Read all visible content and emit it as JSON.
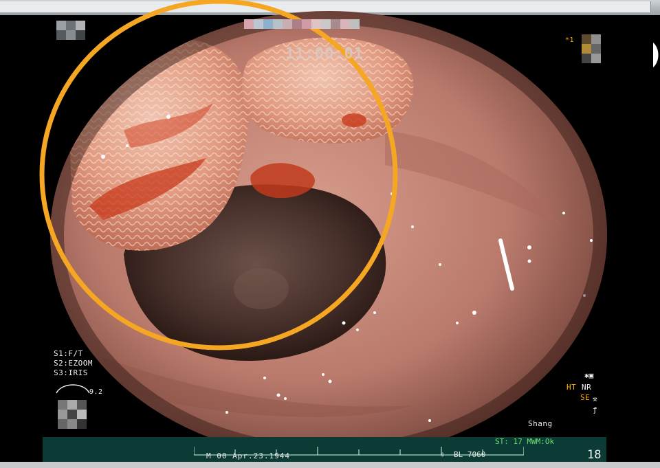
{
  "image": {
    "kind": "endoscopy-frame",
    "overlay_annotation": "orange-circle",
    "accent_color": "#f5a623"
  },
  "osd": {
    "clock": "11:00:01",
    "marker": "*1",
    "s1": "S1:F/T",
    "s2": "S2:EZOOM",
    "s3": "S3:IRIS",
    "iris_value": "9.2",
    "ht": "HT",
    "nr": "NR",
    "se": "SE",
    "operator": "Shang",
    "st_mwm": "ST: 17  MWM:Ok",
    "date": "Apr.23.1944",
    "date_prefix": "M   00",
    "bl": "BL 7060",
    "frame_count": "18"
  },
  "colors": {
    "mucosa": "#c98b7d",
    "lumen": "#3a2620",
    "lesion": "#d0603c",
    "osd_text": "#f0f0f0",
    "osd_yellow": "#ffb000",
    "osd_green": "#6fe06f",
    "info_bar": "#0c3b36"
  }
}
